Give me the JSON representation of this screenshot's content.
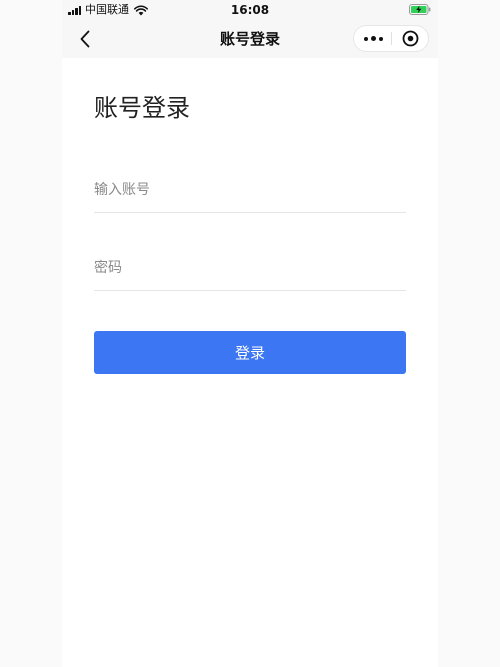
{
  "status_bar": {
    "carrier": "中国联通",
    "time": "16:08",
    "signal_icon": "signal-icon",
    "wifi_icon": "wifi-icon",
    "battery_icon": "battery-charging-icon"
  },
  "nav_bar": {
    "title": "账号登录",
    "back_icon": "chevron-left-icon",
    "more_icon": "more-dots-icon",
    "close_icon": "target-circle-icon"
  },
  "form": {
    "heading": "账号登录",
    "account": {
      "placeholder": "输入账号",
      "value": ""
    },
    "password": {
      "placeholder": "密码",
      "value": ""
    },
    "login_label": "登录"
  },
  "colors": {
    "primary_button": "#3c76f2",
    "nav_background": "#f7f7f7",
    "page_background": "#ffffff",
    "battery_charging": "#30d158"
  }
}
